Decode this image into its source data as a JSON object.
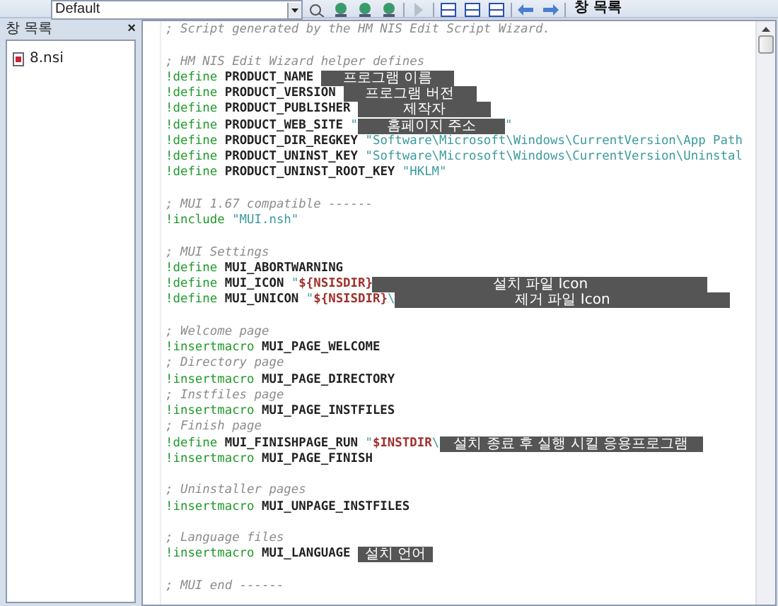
{
  "toolbar": {
    "combo": "Default",
    "window_list_button": "창 목록"
  },
  "panel": {
    "title": "창 목록",
    "close": "×",
    "items": [
      {
        "label": "8.nsi",
        "selected": false
      }
    ]
  },
  "editor": {
    "lines": [
      {
        "kind": "code",
        "tokens": [
          {
            "kind": "comment",
            "text": "; Script generated by the HM NIS Edit Script Wizard."
          }
        ]
      },
      {
        "kind": "blank"
      },
      {
        "kind": "code",
        "tokens": [
          {
            "kind": "comment",
            "text": "; HM NIS Edit Wizard helper defines"
          }
        ]
      },
      {
        "kind": "code",
        "tokens": [
          {
            "kind": "keyword",
            "text": "!define"
          },
          {
            "kind": "ident",
            "text": " PRODUCT_NAME "
          },
          {
            "kind": "masked",
            "text": "프로그램 이름"
          }
        ]
      },
      {
        "kind": "code",
        "tokens": [
          {
            "kind": "keyword",
            "text": "!define"
          },
          {
            "kind": "ident",
            "text": " PRODUCT_VERSION "
          },
          {
            "kind": "masked",
            "text": "프로그램 버전"
          }
        ]
      },
      {
        "kind": "code",
        "tokens": [
          {
            "kind": "keyword",
            "text": "!define"
          },
          {
            "kind": "ident",
            "text": " PRODUCT_PUBLISHER "
          },
          {
            "kind": "masked",
            "text": "제작자"
          }
        ]
      },
      {
        "kind": "code",
        "tokens": [
          {
            "kind": "keyword",
            "text": "!define"
          },
          {
            "kind": "ident",
            "text": " PRODUCT_WEB_SITE "
          },
          {
            "kind": "string",
            "text": "\""
          },
          {
            "kind": "masked",
            "text": "홈페이지 주소"
          },
          {
            "kind": "string",
            "text": "\""
          }
        ]
      },
      {
        "kind": "code",
        "tokens": [
          {
            "kind": "keyword",
            "text": "!define"
          },
          {
            "kind": "ident",
            "text": " PRODUCT_DIR_REGKEY "
          },
          {
            "kind": "string",
            "text": "\"Software\\Microsoft\\Windows\\CurrentVersion\\App Path"
          }
        ]
      },
      {
        "kind": "code",
        "tokens": [
          {
            "kind": "keyword",
            "text": "!define"
          },
          {
            "kind": "ident",
            "text": " PRODUCT_UNINST_KEY "
          },
          {
            "kind": "string",
            "text": "\"Software\\Microsoft\\Windows\\CurrentVersion\\Uninstal"
          }
        ]
      },
      {
        "kind": "code",
        "tokens": [
          {
            "kind": "keyword",
            "text": "!define"
          },
          {
            "kind": "ident",
            "text": " PRODUCT_UNINST_ROOT_KEY "
          },
          {
            "kind": "string",
            "text": "\"HKLM\""
          }
        ]
      },
      {
        "kind": "blank"
      },
      {
        "kind": "code",
        "tokens": [
          {
            "kind": "comment",
            "text": "; MUI 1.67 compatible ------"
          }
        ]
      },
      {
        "kind": "code",
        "tokens": [
          {
            "kind": "keyword",
            "text": "!include"
          },
          {
            "kind": "string",
            "text": " \"MUI.nsh\""
          }
        ]
      },
      {
        "kind": "blank"
      },
      {
        "kind": "code",
        "tokens": [
          {
            "kind": "comment",
            "text": "; MUI Settings"
          }
        ]
      },
      {
        "kind": "code",
        "tokens": [
          {
            "kind": "keyword",
            "text": "!define"
          },
          {
            "kind": "ident",
            "text": " MUI_ABORTWARNING"
          }
        ]
      },
      {
        "kind": "code",
        "tokens": [
          {
            "kind": "keyword",
            "text": "!define"
          },
          {
            "kind": "ident",
            "text": " MUI_ICON "
          },
          {
            "kind": "string",
            "text": "\""
          },
          {
            "kind": "var",
            "text": "${NSISDIR}"
          },
          {
            "kind": "masked",
            "text": "설치 파일 Icon"
          }
        ]
      },
      {
        "kind": "code",
        "tokens": [
          {
            "kind": "keyword",
            "text": "!define"
          },
          {
            "kind": "ident",
            "text": " MUI_UNICON "
          },
          {
            "kind": "string",
            "text": "\""
          },
          {
            "kind": "var",
            "text": "${NSISDIR}"
          },
          {
            "kind": "string",
            "text": "\\"
          },
          {
            "kind": "masked",
            "text": "제거 파일 Icon"
          }
        ]
      },
      {
        "kind": "blank"
      },
      {
        "kind": "code",
        "tokens": [
          {
            "kind": "comment",
            "text": "; Welcome page"
          }
        ]
      },
      {
        "kind": "code",
        "tokens": [
          {
            "kind": "keyword",
            "text": "!insertmacro"
          },
          {
            "kind": "ident",
            "text": " MUI_PAGE_WELCOME"
          }
        ]
      },
      {
        "kind": "code",
        "tokens": [
          {
            "kind": "comment",
            "text": "; Directory page"
          }
        ]
      },
      {
        "kind": "code",
        "tokens": [
          {
            "kind": "keyword",
            "text": "!insertmacro"
          },
          {
            "kind": "ident",
            "text": " MUI_PAGE_DIRECTORY"
          }
        ]
      },
      {
        "kind": "code",
        "tokens": [
          {
            "kind": "comment",
            "text": "; Instfiles page"
          }
        ]
      },
      {
        "kind": "code",
        "tokens": [
          {
            "kind": "keyword",
            "text": "!insertmacro"
          },
          {
            "kind": "ident",
            "text": " MUI_PAGE_INSTFILES"
          }
        ]
      },
      {
        "kind": "code",
        "tokens": [
          {
            "kind": "comment",
            "text": "; Finish page"
          }
        ]
      },
      {
        "kind": "code",
        "tokens": [
          {
            "kind": "keyword",
            "text": "!define"
          },
          {
            "kind": "ident",
            "text": " MUI_FINISHPAGE_RUN "
          },
          {
            "kind": "string",
            "text": "\""
          },
          {
            "kind": "var",
            "text": "$INSTDIR"
          },
          {
            "kind": "string",
            "text": "\\"
          },
          {
            "kind": "masked",
            "text": "설치 종료 후 실행 시킬 응용프로그램"
          }
        ]
      },
      {
        "kind": "code",
        "tokens": [
          {
            "kind": "keyword",
            "text": "!insertmacro"
          },
          {
            "kind": "ident",
            "text": " MUI_PAGE_FINISH"
          }
        ]
      },
      {
        "kind": "blank"
      },
      {
        "kind": "code",
        "tokens": [
          {
            "kind": "comment",
            "text": "; Uninstaller pages"
          }
        ]
      },
      {
        "kind": "code",
        "tokens": [
          {
            "kind": "keyword",
            "text": "!insertmacro"
          },
          {
            "kind": "ident",
            "text": " MUI_UNPAGE_INSTFILES"
          }
        ]
      },
      {
        "kind": "blank"
      },
      {
        "kind": "code",
        "tokens": [
          {
            "kind": "comment",
            "text": "; Language files"
          }
        ]
      },
      {
        "kind": "code",
        "tokens": [
          {
            "kind": "keyword",
            "text": "!insertmacro"
          },
          {
            "kind": "ident",
            "text": " MUI_LANGUAGE "
          },
          {
            "kind": "masked",
            "text": "설치 언어"
          }
        ]
      },
      {
        "kind": "blank"
      },
      {
        "kind": "code",
        "tokens": [
          {
            "kind": "comment",
            "text": "; MUI end ------"
          }
        ]
      }
    ]
  }
}
